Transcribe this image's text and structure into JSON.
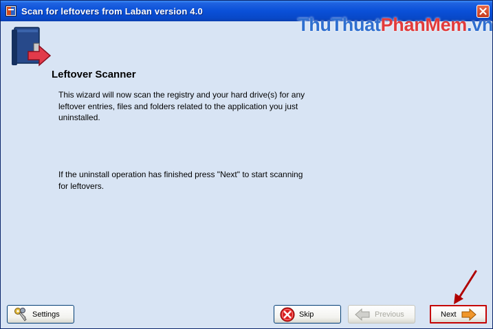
{
  "window": {
    "title": "Scan for leftovers from Laban version 4.0",
    "close_icon": "close-icon"
  },
  "watermark": {
    "part1": "ThuThuat",
    "part2": "PhanMem",
    "part3": ".vn"
  },
  "content": {
    "heading": "Leftover Scanner",
    "paragraph1": "This wizard will now scan the registry and your hard drive(s) for any leftover entries, files and folders related to the application you just uninstalled.",
    "paragraph2": "If the uninstall operation has finished press \"Next\" to start scanning for leftovers."
  },
  "buttons": {
    "settings": "Settings",
    "skip": "Skip",
    "previous": "Previous",
    "next": "Next"
  },
  "icons": {
    "app": "app-icon",
    "wizard": "book-exit-icon",
    "settings": "keys-icon",
    "skip": "cancel-icon",
    "previous": "arrow-left-icon",
    "next": "arrow-right-icon",
    "annotation": "red-arrow-pointer-icon"
  },
  "colors": {
    "titlebar": "#0a50d8",
    "window_bg": "#d8e4f4",
    "next_highlight": "#c40000",
    "watermark_blue": "#2f6fd0",
    "watermark_red": "#e23b3b"
  }
}
